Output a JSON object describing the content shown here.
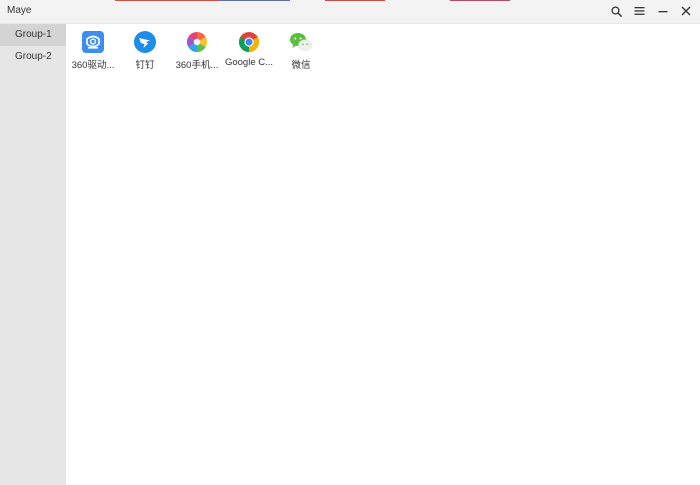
{
  "window": {
    "title": "Maye"
  },
  "titlebar": {
    "buttons": [
      {
        "name": "search-icon"
      },
      {
        "name": "menu-icon"
      },
      {
        "name": "minimize-icon"
      },
      {
        "name": "close-icon"
      }
    ]
  },
  "sidebar": {
    "groups": [
      {
        "label": "Group-1",
        "active": true
      },
      {
        "label": "Group-2",
        "active": false
      }
    ]
  },
  "apps": [
    {
      "label": "360驱动...",
      "icon": "360-driver-icon",
      "color": "#3d8ef0"
    },
    {
      "label": "钉钉",
      "icon": "dingtalk-icon",
      "color": "#1c8de8"
    },
    {
      "label": "360手机...",
      "icon": "360-phone-icon",
      "color": "#f26a3d"
    },
    {
      "label": "Google C...",
      "icon": "chrome-icon",
      "color": "#db4437"
    },
    {
      "label": "微信",
      "icon": "wechat-icon",
      "color": "#59c03a"
    }
  ],
  "colors": {
    "titlebar_bg": "#f3f3f3",
    "sidebar_bg": "#e6e6e6",
    "sidebar_active": "#d4d4d4",
    "main_bg": "#ffffff"
  }
}
